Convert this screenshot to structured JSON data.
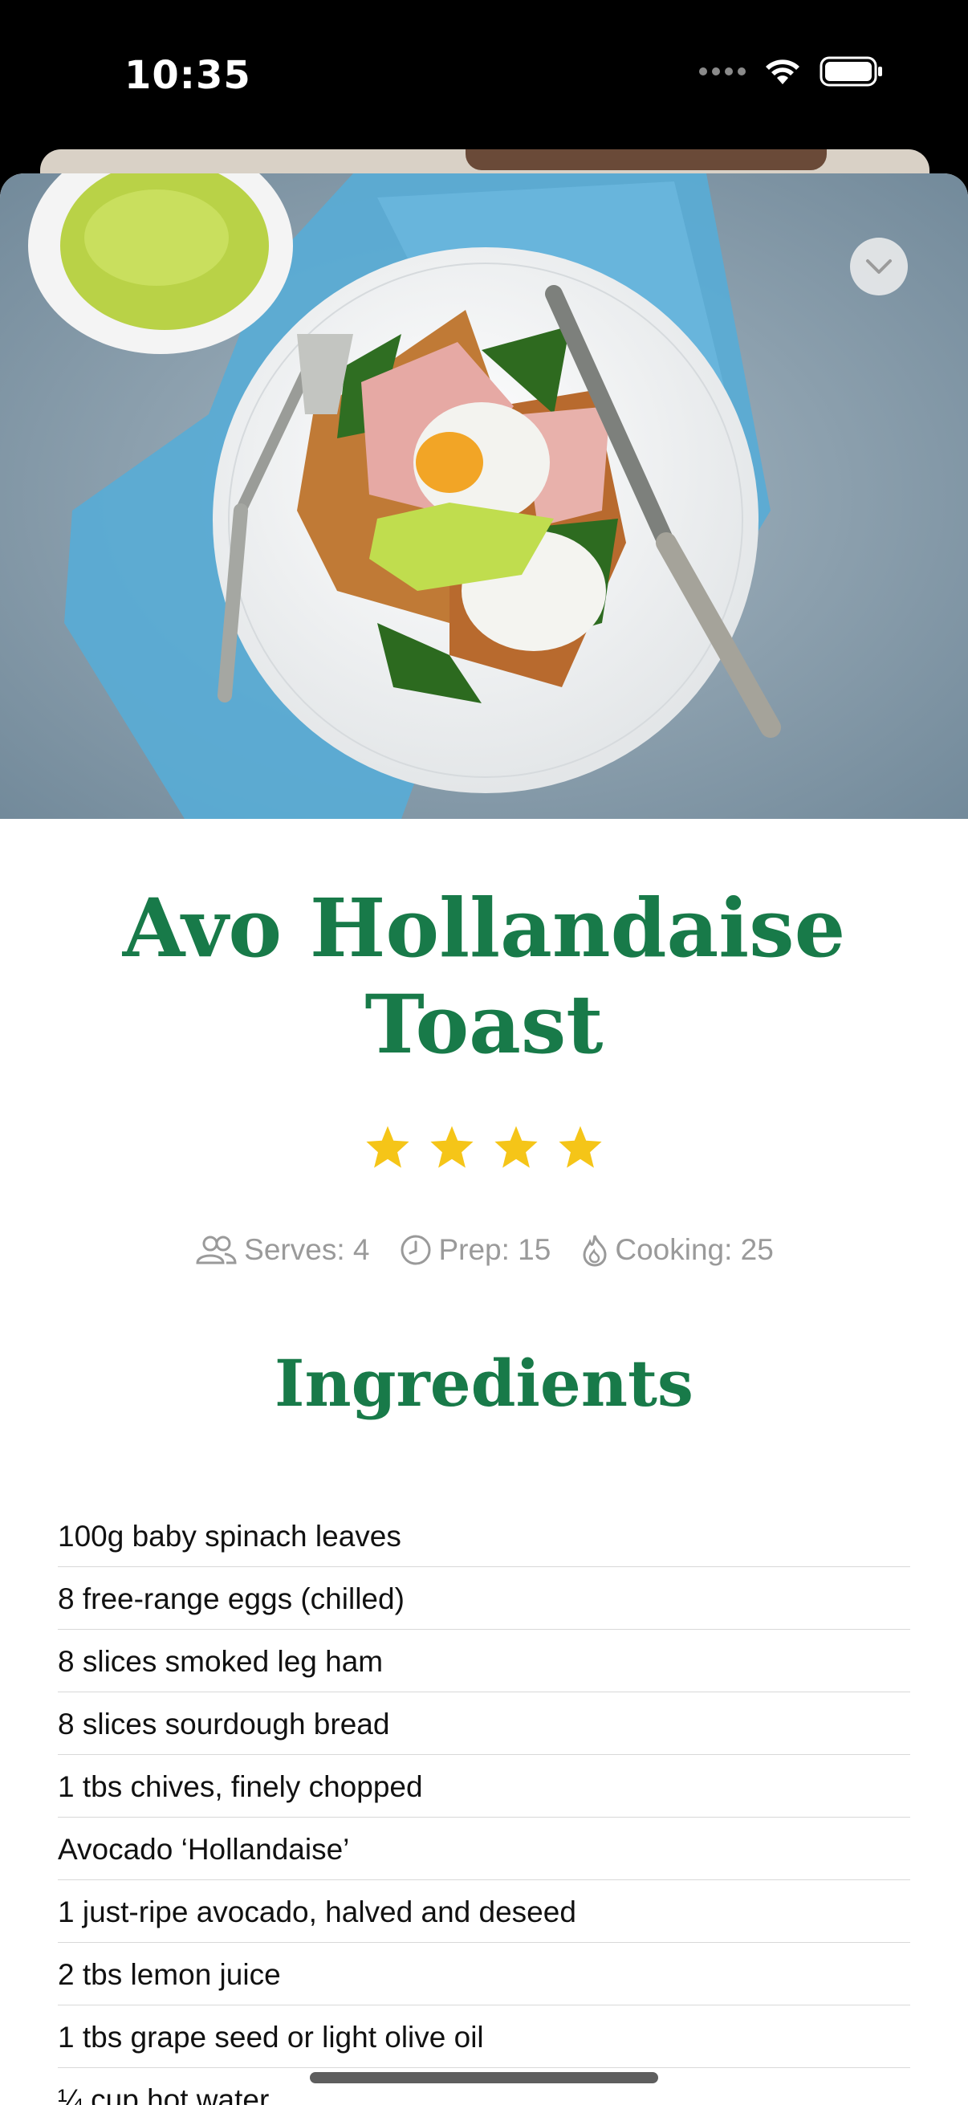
{
  "status_bar": {
    "time": "10:35"
  },
  "recipe": {
    "title": "Avo Hollandaise Toast",
    "rating": 4,
    "rating_max": 4,
    "serves": "Serves: 4",
    "prep": "Prep: 15",
    "cooking": "Cooking: 25"
  },
  "ingredients": {
    "heading": "Ingredients",
    "items": [
      "100g baby spinach leaves",
      "8 free-range eggs (chilled)",
      "8 slices smoked leg ham",
      "8 slices sourdough bread",
      "1 tbs chives, finely chopped",
      "Avocado ‘Hollandaise’",
      "1 just-ripe avocado, halved and deseed",
      "2 tbs lemon juice",
      "1 tbs grape seed or light olive oil",
      "¼ cup hot water"
    ]
  },
  "colors": {
    "accent": "#187a49",
    "star": "#f5c518",
    "meta": "#9a9a9a"
  },
  "icons": [
    "wifi-icon",
    "battery-icon",
    "chevron-down-icon",
    "people-icon",
    "clock-icon",
    "flame-icon",
    "star-icon"
  ]
}
